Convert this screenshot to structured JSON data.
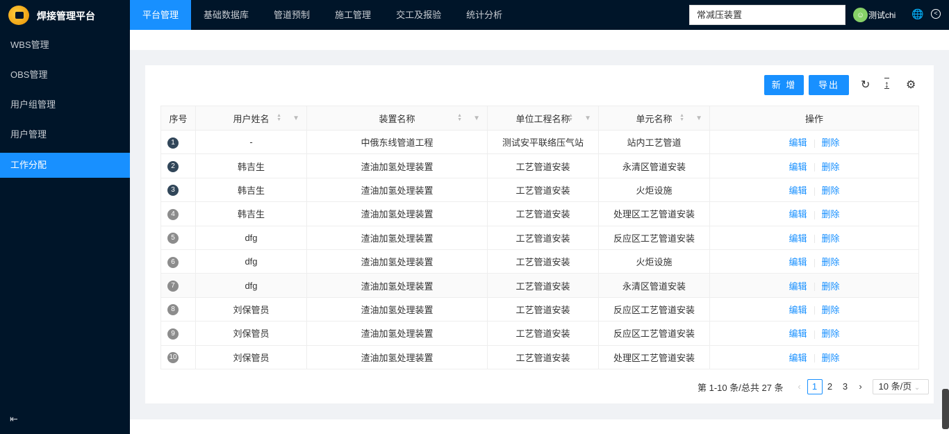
{
  "app": {
    "title": "焊接管理平台"
  },
  "nav": [
    {
      "label": "平台管理",
      "active": true
    },
    {
      "label": "基础数据库"
    },
    {
      "label": "管道预制"
    },
    {
      "label": "施工管理"
    },
    {
      "label": "交工及报验"
    },
    {
      "label": "统计分析"
    }
  ],
  "header": {
    "project_select": "常减压装置",
    "user_name": "测试chi"
  },
  "sidebar": [
    {
      "label": "WBS管理"
    },
    {
      "label": "OBS管理"
    },
    {
      "label": "用户组管理"
    },
    {
      "label": "用户管理"
    },
    {
      "label": "工作分配",
      "active": true
    }
  ],
  "toolbar": {
    "add_label": "新 增",
    "export_label": "导出"
  },
  "table": {
    "columns": [
      "序号",
      "用户姓名",
      "装置名称",
      "单位工程名称",
      "单元名称",
      "操作"
    ],
    "edit_label": "编辑",
    "delete_label": "删除",
    "rows": [
      {
        "idx": "1",
        "user": "-",
        "device": "中俄东线管道工程",
        "unit_project": "测试安平联络压气站",
        "unit": "站内工艺管道"
      },
      {
        "idx": "2",
        "user": "韩吉生",
        "device": "渣油加氢处理装置",
        "unit_project": "工艺管道安装",
        "unit": "永清区管道安装"
      },
      {
        "idx": "3",
        "user": "韩吉生",
        "device": "渣油加氢处理装置",
        "unit_project": "工艺管道安装",
        "unit": "火炬设施"
      },
      {
        "idx": "4",
        "user": "韩吉生",
        "device": "渣油加氢处理装置",
        "unit_project": "工艺管道安装",
        "unit": "处理区工艺管道安装"
      },
      {
        "idx": "5",
        "user": "dfg",
        "device": "渣油加氢处理装置",
        "unit_project": "工艺管道安装",
        "unit": "反应区工艺管道安装"
      },
      {
        "idx": "6",
        "user": "dfg",
        "device": "渣油加氢处理装置",
        "unit_project": "工艺管道安装",
        "unit": "火炬设施"
      },
      {
        "idx": "7",
        "user": "dfg",
        "device": "渣油加氢处理装置",
        "unit_project": "工艺管道安装",
        "unit": "永清区管道安装"
      },
      {
        "idx": "8",
        "user": "刘保管员",
        "device": "渣油加氢处理装置",
        "unit_project": "工艺管道安装",
        "unit": "反应区工艺管道安装"
      },
      {
        "idx": "9",
        "user": "刘保管员",
        "device": "渣油加氢处理装置",
        "unit_project": "工艺管道安装",
        "unit": "反应区工艺管道安装"
      },
      {
        "idx": "10",
        "user": "刘保管员",
        "device": "渣油加氢处理装置",
        "unit_project": "工艺管道安装",
        "unit": "处理区工艺管道安装"
      }
    ]
  },
  "pagination": {
    "summary": "第 1-10 条/总共 27 条",
    "pages": [
      "1",
      "2",
      "3"
    ],
    "current": "1",
    "page_size": "10 条/页"
  },
  "colors": {
    "primary": "#1890ff",
    "dark": "#001529",
    "badge_top": "#314659",
    "badge_rest": "#8c8c8c"
  }
}
